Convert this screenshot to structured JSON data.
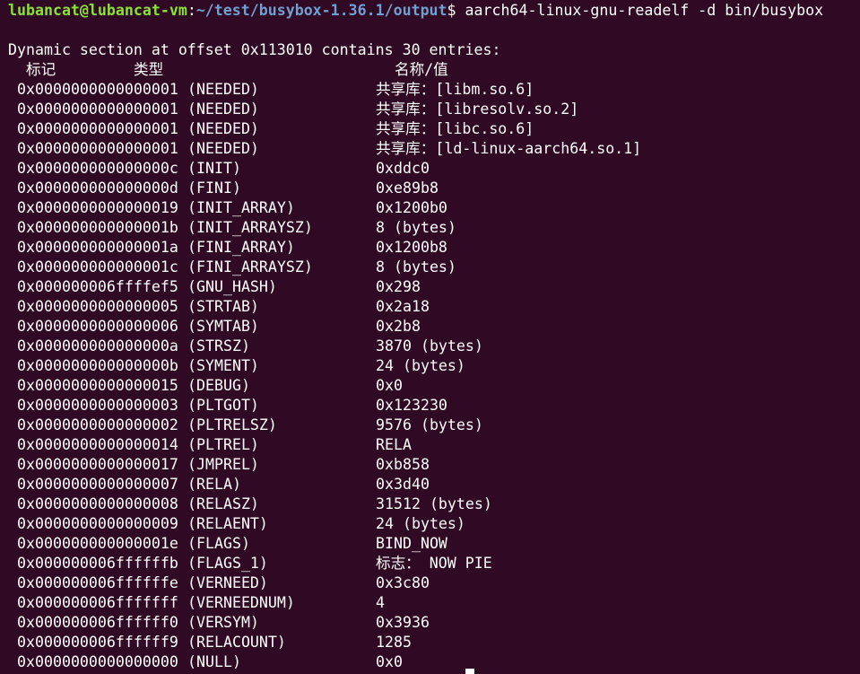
{
  "prompt": {
    "user_host": "lubancat@lubancat-vm",
    "separator": ":",
    "path": "~/test/busybox-1.36.1/output",
    "dollar": "$",
    "command": " aarch64-linux-gnu-readelf -d bin/busybox"
  },
  "summary": "Dynamic section at offset 0x113010 contains 30 entries:",
  "headers": {
    "tag": "标记",
    "type": "类型",
    "value": "名称/值"
  },
  "entries": [
    {
      "tag": "0x0000000000000001",
      "type": "(NEEDED)",
      "value": "共享库：[libm.so.6]"
    },
    {
      "tag": "0x0000000000000001",
      "type": "(NEEDED)",
      "value": "共享库：[libresolv.so.2]"
    },
    {
      "tag": "0x0000000000000001",
      "type": "(NEEDED)",
      "value": "共享库：[libc.so.6]"
    },
    {
      "tag": "0x0000000000000001",
      "type": "(NEEDED)",
      "value": "共享库：[ld-linux-aarch64.so.1]"
    },
    {
      "tag": "0x000000000000000c",
      "type": "(INIT)",
      "value": "0xddc0"
    },
    {
      "tag": "0x000000000000000d",
      "type": "(FINI)",
      "value": "0xe89b8"
    },
    {
      "tag": "0x0000000000000019",
      "type": "(INIT_ARRAY)",
      "value": "0x1200b0"
    },
    {
      "tag": "0x000000000000001b",
      "type": "(INIT_ARRAYSZ)",
      "value": "8 (bytes)"
    },
    {
      "tag": "0x000000000000001a",
      "type": "(FINI_ARRAY)",
      "value": "0x1200b8"
    },
    {
      "tag": "0x000000000000001c",
      "type": "(FINI_ARRAYSZ)",
      "value": "8 (bytes)"
    },
    {
      "tag": "0x000000006ffffef5",
      "type": "(GNU_HASH)",
      "value": "0x298"
    },
    {
      "tag": "0x0000000000000005",
      "type": "(STRTAB)",
      "value": "0x2a18"
    },
    {
      "tag": "0x0000000000000006",
      "type": "(SYMTAB)",
      "value": "0x2b8"
    },
    {
      "tag": "0x000000000000000a",
      "type": "(STRSZ)",
      "value": "3870 (bytes)"
    },
    {
      "tag": "0x000000000000000b",
      "type": "(SYMENT)",
      "value": "24 (bytes)"
    },
    {
      "tag": "0x0000000000000015",
      "type": "(DEBUG)",
      "value": "0x0"
    },
    {
      "tag": "0x0000000000000003",
      "type": "(PLTGOT)",
      "value": "0x123230"
    },
    {
      "tag": "0x0000000000000002",
      "type": "(PLTRELSZ)",
      "value": "9576 (bytes)"
    },
    {
      "tag": "0x0000000000000014",
      "type": "(PLTREL)",
      "value": "RELA"
    },
    {
      "tag": "0x0000000000000017",
      "type": "(JMPREL)",
      "value": "0xb858"
    },
    {
      "tag": "0x0000000000000007",
      "type": "(RELA)",
      "value": "0x3d40"
    },
    {
      "tag": "0x0000000000000008",
      "type": "(RELASZ)",
      "value": "31512 (bytes)"
    },
    {
      "tag": "0x0000000000000009",
      "type": "(RELAENT)",
      "value": "24 (bytes)"
    },
    {
      "tag": "0x000000000000001e",
      "type": "(FLAGS)",
      "value": "BIND_NOW"
    },
    {
      "tag": "0x000000006ffffffb",
      "type": "(FLAGS_1)",
      "value": "标志： NOW PIE"
    },
    {
      "tag": "0x000000006ffffffe",
      "type": "(VERNEED)",
      "value": "0x3c80"
    },
    {
      "tag": "0x000000006fffffff",
      "type": "(VERNEEDNUM)",
      "value": "4"
    },
    {
      "tag": "0x000000006ffffff0",
      "type": "(VERSYM)",
      "value": "0x3936"
    },
    {
      "tag": "0x000000006ffffff9",
      "type": "(RELACOUNT)",
      "value": "1285"
    },
    {
      "tag": "0x0000000000000000",
      "type": "(NULL)",
      "value": "0x0"
    }
  ]
}
